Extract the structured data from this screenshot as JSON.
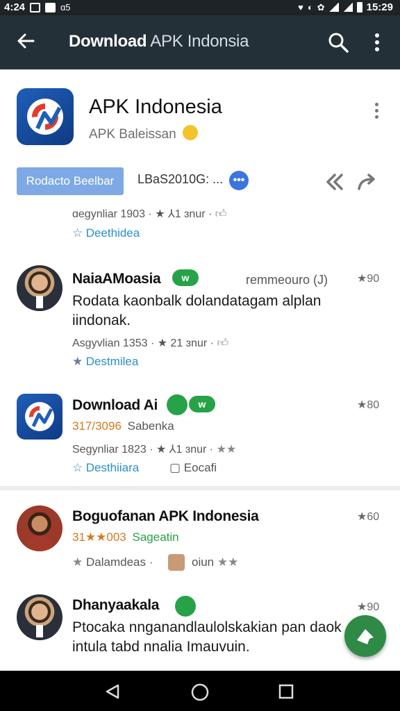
{
  "status_bar": {
    "time_left": "4:24",
    "sim_text": "ɑ5",
    "time_right": "15:29"
  },
  "app_bar": {
    "title_bold": "Download",
    "title_light": " APK Indonsia"
  },
  "header": {
    "app_name": "APK Indonesia",
    "developer": "APK Baleissan",
    "primary_button": "Rodacto Beelbar",
    "stats": "LBaS2010G: ...",
    "stats_badge": "•••",
    "review_meta": "ɑeɡynliar 1903 · ★ ⅄1 ɜnur ·",
    "tag": "Deethidea"
  },
  "reviews": [
    {
      "name": "NaiaAMoasia",
      "badge": "w",
      "right_label": "remmeouro (J)",
      "rating": "★90",
      "text_line1": "Rodata kaonbalk dolandatagam alplan",
      "text_line2": "iindonak.",
      "meta": "Asgyvlian 1353 · ★ 21 ɜnur ·",
      "tag": "Destmilea"
    },
    {
      "name": "Download Ai",
      "rating": "★80",
      "subline_num": "317/3096",
      "subline_text": "Sabenka",
      "meta": "Segynliar 1823 · ★ ⅄1 ɜnur ·",
      "tag": "Desthiiara",
      "tag2": "Eocafi"
    },
    {
      "name": "Boguofanan APK Indonesia",
      "rating": "★60",
      "subline_num": "31★★003",
      "subline_text": "Sageatin",
      "tag": "Dalamdeas",
      "tag2": "oiun"
    },
    {
      "name": "Dhanyaakala",
      "rating": "★90",
      "text_line1": "Ptocaka nnganandlaulolskakian pan daok",
      "text_line2": "intula tabd nnalia Imauvuin."
    }
  ]
}
